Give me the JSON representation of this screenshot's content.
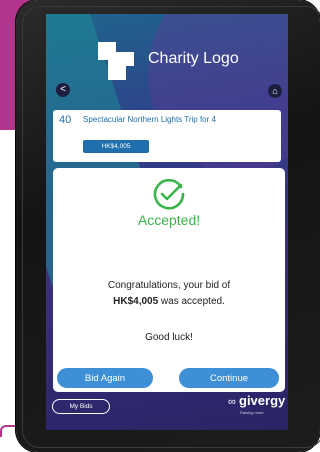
{
  "header": {
    "logo_text": "Charity Logo"
  },
  "nav": {
    "back_glyph": "<",
    "home_glyph": "⌂"
  },
  "item": {
    "number": "40",
    "title": "Spectacular Northern Lights Trip for 4",
    "price": "HK$4,005"
  },
  "dialog": {
    "icon": "check-circle-icon",
    "status": "Accepted!",
    "message_line1": "Congratulations, your bid of",
    "amount": "HK$4,005",
    "message_line2_suffix": " was accepted.",
    "good_luck": "Good luck!",
    "bid_again_label": "Bid Again",
    "continue_label": "Continue"
  },
  "footer": {
    "my_bids_label": "My Bids",
    "brand_name": "givergy",
    "brand_tagline": "Raising more"
  },
  "colors": {
    "accent_blue": "#3d8fd6",
    "link_blue": "#1f6fae",
    "success_green": "#39b54a",
    "brand_magenta": "#b3348c"
  }
}
